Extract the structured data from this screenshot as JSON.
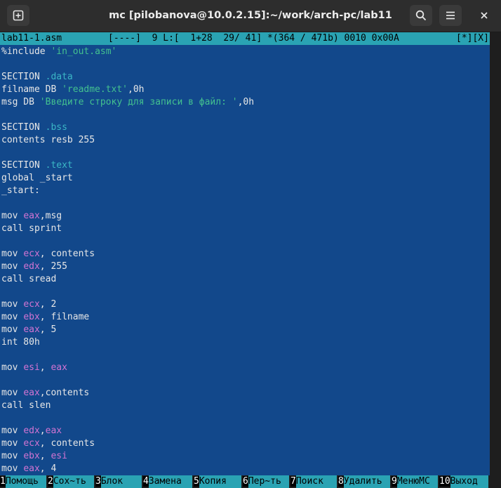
{
  "window": {
    "title": "mc [pilobanova@10.0.2.15]:~/work/arch-pc/lab11"
  },
  "icons": {
    "new_tab": "new-tab-icon",
    "search": "search-icon",
    "menu": "hamburger-menu-icon",
    "close": "close-icon"
  },
  "editor": {
    "status": {
      "file": "lab11-1.asm",
      "info": "[----]  9 L:[  1+28  29/ 41] *(364 / 471b) 0010 0x00A",
      "flags": "[*][X]"
    },
    "lines": [
      [
        {
          "t": "%include ",
          "c": "kw"
        },
        {
          "t": "'in_out.asm'",
          "c": "str"
        }
      ],
      [],
      [
        {
          "t": "SECTION ",
          "c": "kw"
        },
        {
          "t": ".data",
          "c": "dir"
        }
      ],
      [
        {
          "t": "filname DB ",
          "c": "kw"
        },
        {
          "t": "'readme.txt'",
          "c": "str"
        },
        {
          "t": ",0h",
          "c": "kw"
        }
      ],
      [
        {
          "t": "msg DB ",
          "c": "kw"
        },
        {
          "t": "'Введите строку для записи в файл: '",
          "c": "str"
        },
        {
          "t": ",0h",
          "c": "kw"
        }
      ],
      [],
      [
        {
          "t": "SECTION ",
          "c": "kw"
        },
        {
          "t": ".bss",
          "c": "dir"
        }
      ],
      [
        {
          "t": "contents resb 255",
          "c": "kw"
        }
      ],
      [],
      [
        {
          "t": "SECTION ",
          "c": "kw"
        },
        {
          "t": ".text",
          "c": "dir"
        }
      ],
      [
        {
          "t": "global _start",
          "c": "kw"
        }
      ],
      [
        {
          "t": "_start:",
          "c": "kw"
        }
      ],
      [],
      [
        {
          "t": "mov ",
          "c": "kw"
        },
        {
          "t": "eax",
          "c": "reg"
        },
        {
          "t": ",msg",
          "c": "kw"
        }
      ],
      [
        {
          "t": "call sprint",
          "c": "kw"
        }
      ],
      [],
      [
        {
          "t": "mov ",
          "c": "kw"
        },
        {
          "t": "ecx",
          "c": "reg"
        },
        {
          "t": ", contents",
          "c": "kw"
        }
      ],
      [
        {
          "t": "mov ",
          "c": "kw"
        },
        {
          "t": "edx",
          "c": "reg"
        },
        {
          "t": ", 255",
          "c": "kw"
        }
      ],
      [
        {
          "t": "call sread",
          "c": "kw"
        }
      ],
      [],
      [
        {
          "t": "mov ",
          "c": "kw"
        },
        {
          "t": "ecx",
          "c": "reg"
        },
        {
          "t": ", 2",
          "c": "kw"
        }
      ],
      [
        {
          "t": "mov ",
          "c": "kw"
        },
        {
          "t": "ebx",
          "c": "reg"
        },
        {
          "t": ", filname",
          "c": "kw"
        }
      ],
      [
        {
          "t": "mov ",
          "c": "kw"
        },
        {
          "t": "eax",
          "c": "reg"
        },
        {
          "t": ", 5",
          "c": "kw"
        }
      ],
      [
        {
          "t": "int 80h",
          "c": "kw"
        }
      ],
      [],
      [
        {
          "t": "mov ",
          "c": "kw"
        },
        {
          "t": "esi",
          "c": "reg"
        },
        {
          "t": ", ",
          "c": "kw"
        },
        {
          "t": "eax",
          "c": "reg"
        }
      ],
      [],
      [
        {
          "t": "mov ",
          "c": "kw"
        },
        {
          "t": "eax",
          "c": "reg"
        },
        {
          "t": ",contents",
          "c": "kw"
        }
      ],
      [
        {
          "t": "call slen",
          "c": "kw"
        }
      ],
      [],
      [
        {
          "t": "mov ",
          "c": "kw"
        },
        {
          "t": "edx",
          "c": "reg"
        },
        {
          "t": ",",
          "c": "kw"
        },
        {
          "t": "eax",
          "c": "reg"
        }
      ],
      [
        {
          "t": "mov ",
          "c": "kw"
        },
        {
          "t": "ecx",
          "c": "reg"
        },
        {
          "t": ", contents",
          "c": "kw"
        }
      ],
      [
        {
          "t": "mov ",
          "c": "kw"
        },
        {
          "t": "ebx",
          "c": "reg"
        },
        {
          "t": ", ",
          "c": "kw"
        },
        {
          "t": "esi",
          "c": "reg"
        }
      ],
      [
        {
          "t": "mov ",
          "c": "kw"
        },
        {
          "t": "eax",
          "c": "reg"
        },
        {
          "t": ", 4",
          "c": "kw"
        }
      ]
    ]
  },
  "fkeys": [
    {
      "num": "1",
      "label": "Помощь"
    },
    {
      "num": "2",
      "label": "Сох~ть"
    },
    {
      "num": "3",
      "label": "Блок"
    },
    {
      "num": "4",
      "label": "Замена"
    },
    {
      "num": "5",
      "label": "Копия"
    },
    {
      "num": "6",
      "label": "Пер~ть"
    },
    {
      "num": "7",
      "label": "Поиск"
    },
    {
      "num": "8",
      "label": "Удалить"
    },
    {
      "num": "9",
      "label": "МенюMC"
    },
    {
      "num": "10",
      "label": "Выход"
    }
  ],
  "colors": {
    "editor_bg": "#12488b",
    "status_bg": "#2aa3b3",
    "string": "#43c18f",
    "register": "#d274d3",
    "directive": "#3bb7c6"
  }
}
